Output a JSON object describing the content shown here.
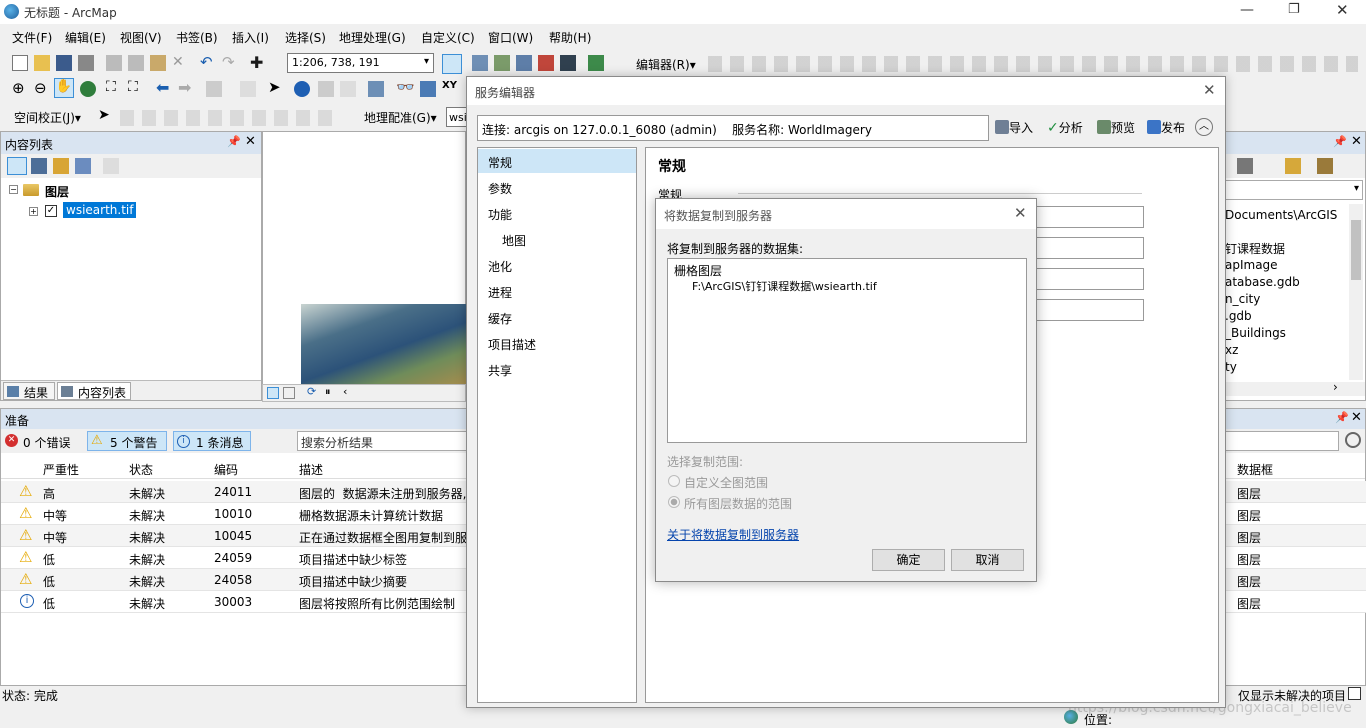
{
  "window": {
    "title": "无标题 - ArcMap"
  },
  "menu": [
    "文件(F)",
    "编辑(E)",
    "视图(V)",
    "书签(B)",
    "插入(I)",
    "选择(S)",
    "地理处理(G)",
    "自定义(C)",
    "窗口(W)",
    "帮助(H)"
  ],
  "toolbar": {
    "scale": "1:206, 738, 191",
    "editor_label": "编辑器(R)▾",
    "spatial_adjust_label": "空间校正(J)▾",
    "georef_label": "地理配准(G)▾",
    "georef_input": "wsi"
  },
  "toc": {
    "title": "内容列表",
    "root": "图层",
    "layer": "wsiearth.tif",
    "tab_results": "结果",
    "tab_toc": "内容列表"
  },
  "prepare": {
    "title": "准备",
    "errors": "0 个错误",
    "warnings": "5 个警告",
    "messages": "1 条消息",
    "search_placeholder": "搜索分析结果",
    "columns": [
      "严重性",
      "状态",
      "编码",
      "描述",
      "数据框"
    ],
    "rows": [
      {
        "icon": "warning",
        "severity": "高",
        "status": "未解决",
        "code": "24011",
        "desc": "图层的  数据源未注册到服务器,",
        "frame": "图层"
      },
      {
        "icon": "warning",
        "severity": "中等",
        "status": "未解决",
        "code": "10010",
        "desc": "栅格数据源未计算统计数据",
        "frame": "图层"
      },
      {
        "icon": "warning",
        "severity": "中等",
        "status": "未解决",
        "code": "10045",
        "desc": "正在通过数据框全图用复制到服",
        "frame": "图层"
      },
      {
        "icon": "warning",
        "severity": "低",
        "status": "未解决",
        "code": "24059",
        "desc": "项目描述中缺少标签",
        "frame": "图层"
      },
      {
        "icon": "warning",
        "severity": "低",
        "status": "未解决",
        "code": "24058",
        "desc": "项目描述中缺少摘要",
        "frame": "图层"
      },
      {
        "icon": "info",
        "severity": "低",
        "status": "未解决",
        "code": "30003",
        "desc": "图层将按照所有比例范围绘制",
        "frame": "图层"
      }
    ],
    "only_unresolved": "仅显示未解决的项目"
  },
  "status": {
    "text": "状态: 完成",
    "position_label": "位置:",
    "watermark": "https://blog.csdn.net/gongxiacai_believe"
  },
  "catalog": {
    "path": "Documents\\ArcGIS",
    "items": [
      "钉课程数据",
      "apImage",
      "atabase.gdb",
      "n_city",
      ".gdb",
      "_Buildings",
      "xz",
      "ty"
    ]
  },
  "service_editor": {
    "title": "服务编辑器",
    "connection": "连接: arcgis on 127.0.0.1_6080 (admin)    服务名称: WorldImagery",
    "import": "导入",
    "analyze": "分析",
    "preview": "预览",
    "publish": "发布",
    "nav": [
      "常规",
      "参数",
      "功能",
      "地图",
      "池化",
      "进程",
      "缓存",
      "项目描述",
      "共享"
    ],
    "heading": "常规",
    "subheading": "常规"
  },
  "copy_dialog": {
    "title": "将数据复制到服务器",
    "list_label": "将复制到服务器的数据集:",
    "group": "栅格图层",
    "file": "F:\\ArcGIS\\钉钉课程数据\\wsiearth.tif",
    "extent_label": "选择复制范围:",
    "opt_custom": "自定义全图范围",
    "opt_all": "所有图层数据的范围",
    "help_link": "关于将数据复制到服务器",
    "ok": "确定",
    "cancel": "取消"
  }
}
